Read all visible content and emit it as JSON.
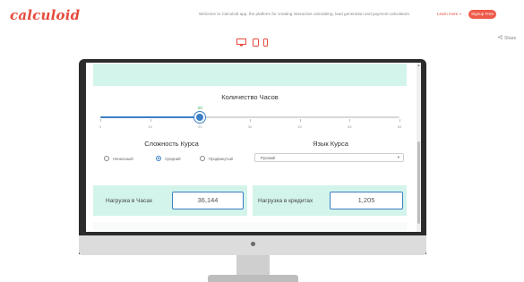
{
  "header": {
    "logo": "calculoid",
    "welcome_text": "Welcome to Calculoid app, the platform for creating interactive calculating, lead generation and payment calculators.",
    "learn_more": "Learn more »",
    "signup_label": "Signup Free"
  },
  "toolbar": {
    "devices": [
      "desktop",
      "tablet",
      "phone"
    ],
    "share_label": "Share"
  },
  "calculator": {
    "hours": {
      "label": "Количество Часов",
      "value": "20",
      "min": 0,
      "max": 60,
      "fraction": 0.333,
      "ticks": [
        "0",
        "10",
        "20",
        "30",
        "40",
        "50",
        "60"
      ]
    },
    "complexity": {
      "label": "Сложность Курса",
      "options": [
        {
          "label": "Начальный",
          "checked": false
        },
        {
          "label": "Средний",
          "checked": true
        },
        {
          "label": "Продвинутый",
          "checked": false
        }
      ]
    },
    "language": {
      "label": "Язык Курса",
      "selected": "Русский"
    },
    "load_hours": {
      "label": "Нагрузка в Часах",
      "value": "36,144"
    },
    "load_credits": {
      "label": "Нагрузка в кредитах",
      "value": "1,205"
    }
  },
  "colors": {
    "brand": "#e64a3c",
    "accent": "#3b7fc4",
    "panel": "#d3f4ea"
  }
}
